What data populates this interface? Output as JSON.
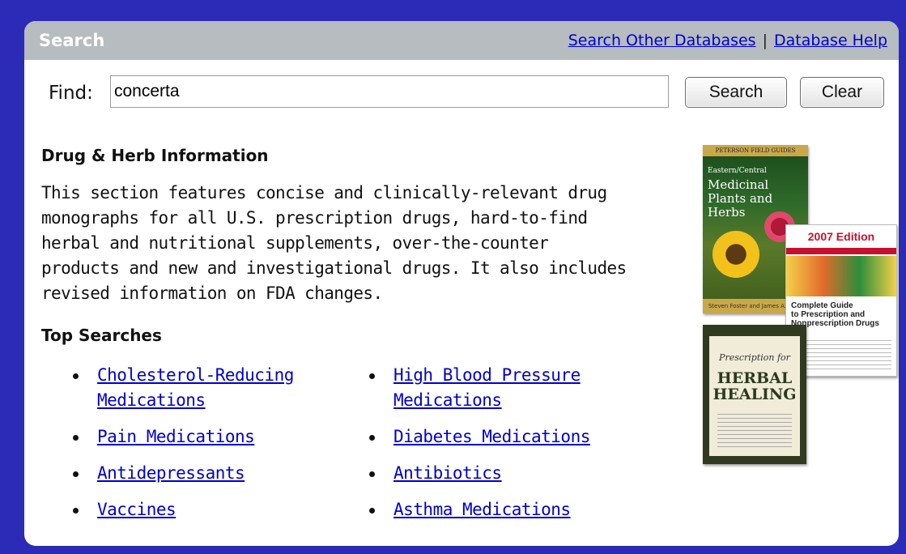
{
  "header": {
    "title": "Search",
    "links": [
      "Search Other Databases",
      "Database Help"
    ],
    "separator": "|"
  },
  "search": {
    "label": "Find:",
    "value": "concerta",
    "search_button": "Search",
    "clear_button": "Clear"
  },
  "info": {
    "title": "Drug & Herb Information",
    "lines": [
      "This section features concise and clinically-relevant drug",
      "monographs for all U.S. prescription drugs, hard-to-find",
      "herbal and nutritional supplements, over-the-counter",
      "products and new and investigational drugs. It also includes",
      "revised information on FDA changes."
    ]
  },
  "top_searches": {
    "title": "Top Searches",
    "col1": [
      [
        "Cholesterol-Reducing",
        "Medications"
      ],
      [
        "Pain Medications"
      ],
      [
        "Antidepressants"
      ],
      [
        "Vaccines"
      ]
    ],
    "col2": [
      [
        "High Blood Pressure",
        "Medications"
      ],
      [
        "Diabetes Medications"
      ],
      [
        "Antibiotics"
      ],
      [
        "Asthma Medications"
      ]
    ]
  },
  "books": [
    {
      "header": "PETERSON FIELD GUIDES",
      "title": [
        "Eastern/Central",
        "Medicinal",
        "Plants and Herbs"
      ],
      "footer": "Steven Foster and James A. Duke"
    },
    {
      "edition": "2007 Edition",
      "title": [
        "Complete Guide",
        "to Prescription and",
        "Nonprescription Drugs"
      ]
    },
    {
      "pre": "Prescription for",
      "title": [
        "HERBAL",
        "HEALING"
      ]
    }
  ]
}
